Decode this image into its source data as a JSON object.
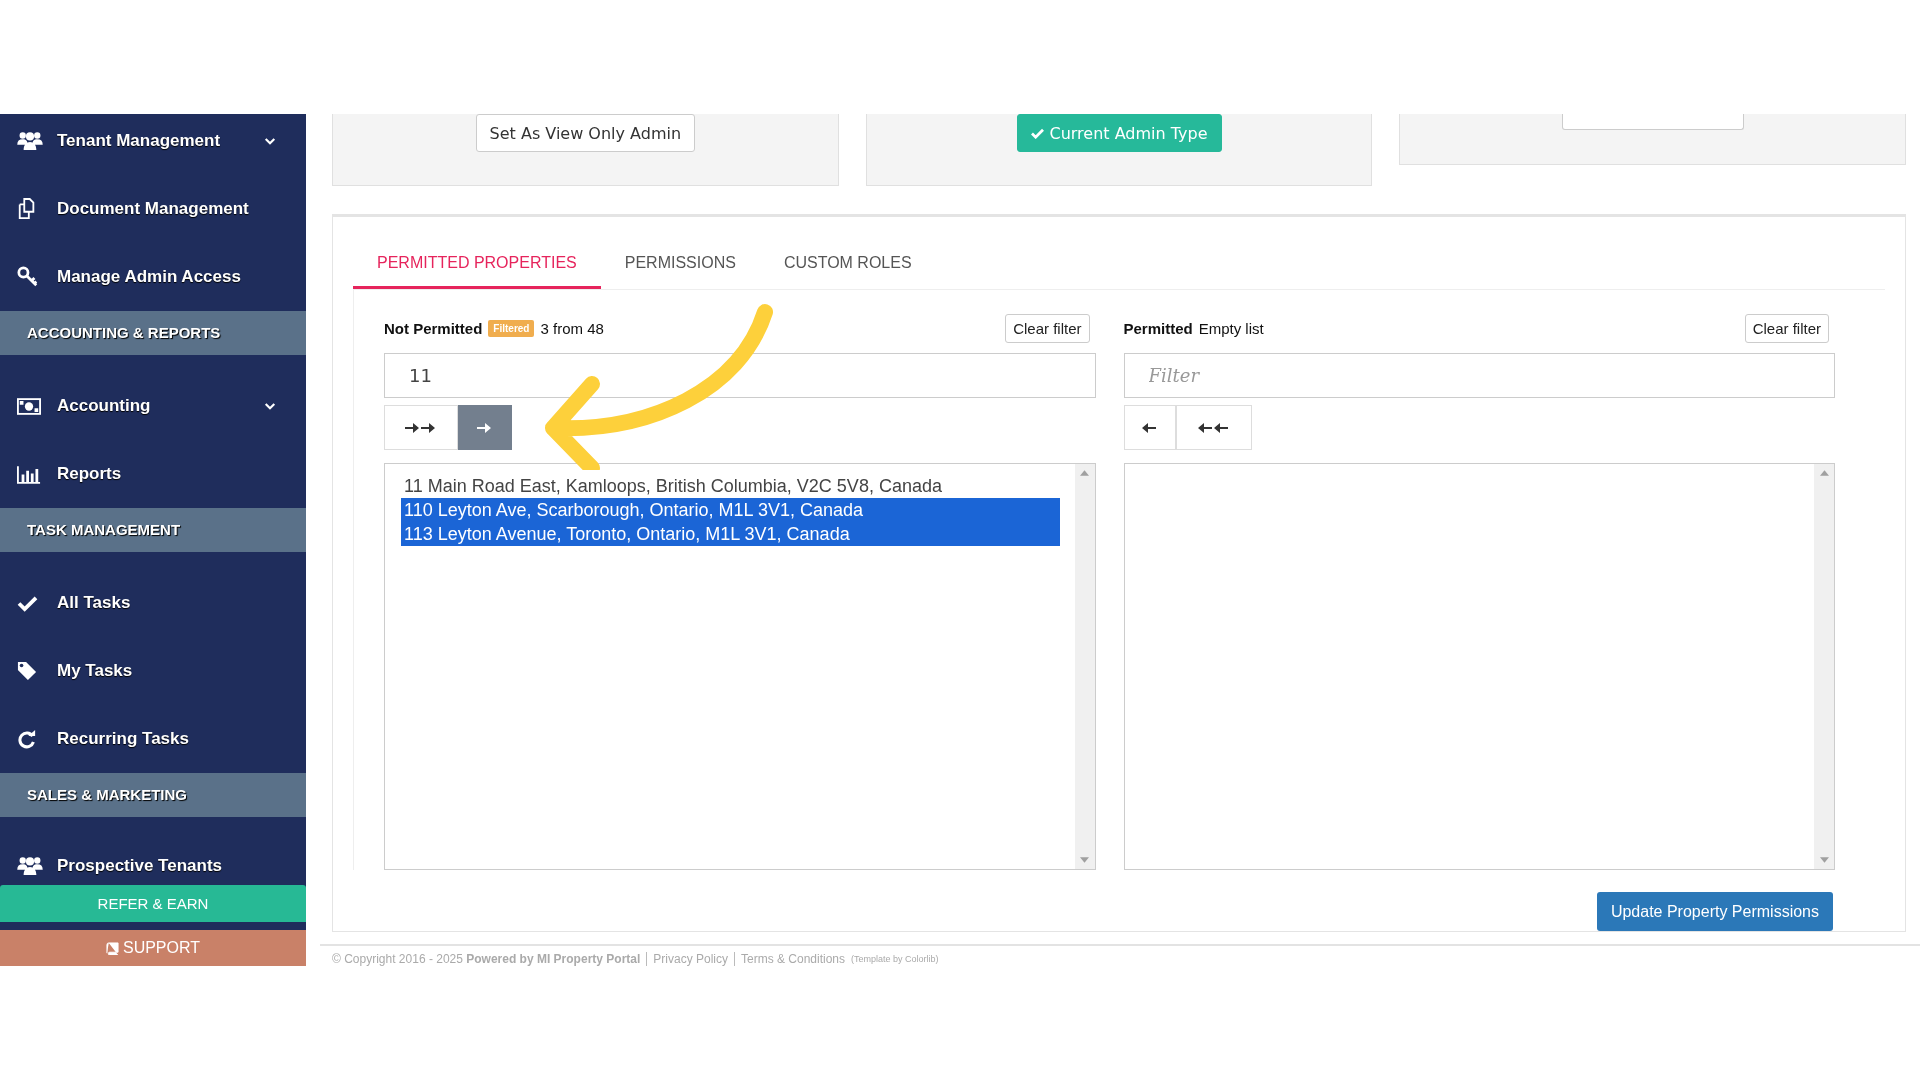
{
  "sidebar": {
    "items": [
      {
        "kind": "item",
        "label": "Tenant Management",
        "expandable": true
      },
      {
        "kind": "item",
        "label": "Document Management",
        "expandable": false
      },
      {
        "kind": "item",
        "label": "Manage Admin Access",
        "expandable": false
      },
      {
        "kind": "header",
        "label": "ACCOUNTING & REPORTS"
      },
      {
        "kind": "item",
        "label": "Accounting",
        "expandable": true
      },
      {
        "kind": "item",
        "label": "Reports",
        "expandable": false
      },
      {
        "kind": "header",
        "label": "TASK MANAGEMENT"
      },
      {
        "kind": "item",
        "label": "All Tasks",
        "expandable": false
      },
      {
        "kind": "item",
        "label": "My Tasks",
        "expandable": false
      },
      {
        "kind": "item",
        "label": "Recurring Tasks",
        "expandable": false
      },
      {
        "kind": "header",
        "label": "SALES & MARKETING"
      },
      {
        "kind": "item",
        "label": "Prospective Tenants",
        "expandable": false
      }
    ],
    "refer_button": "REFER & EARN",
    "support_button": "SUPPORT"
  },
  "admin_types": [
    {
      "label": "Set As View Only Admin",
      "current": false
    },
    {
      "label": "Current Admin Type",
      "current": true
    },
    {
      "current": false
    }
  ],
  "tabs": [
    {
      "label": "PERMITTED PROPERTIES",
      "selected": true
    },
    {
      "label": "PERMISSIONS",
      "selected": false
    },
    {
      "label": "CUSTOM ROLES",
      "selected": false
    }
  ],
  "not_permitted": {
    "title": "Not Permitted",
    "badge": "Filtered",
    "count": "3 from 48",
    "clear_button": "Clear filter",
    "filter_value": "11",
    "options": [
      {
        "label": "11 Main Road East, Kamloops, British Columbia, V2C 5V8, Canada",
        "selected": false
      },
      {
        "label": "110 Leyton Ave, Scarborough, Ontario, M1L 3V1, Canada",
        "selected": true
      },
      {
        "label": "113 Leyton Avenue, Toronto, Ontario, M1L 3V1, Canada",
        "selected": true
      }
    ]
  },
  "permitted": {
    "title": "Permitted",
    "count": "Empty list",
    "clear_button": "Clear filter",
    "filter_placeholder": "Filter"
  },
  "update_button": "Update Property Permissions",
  "footer": {
    "copyright": "© Copyright 2016 - 2025",
    "powered": "Powered by MI Property Portal",
    "privacy": "Privacy Policy",
    "terms": "Terms & Conditions",
    "template": "(Template by Colorlib)"
  }
}
